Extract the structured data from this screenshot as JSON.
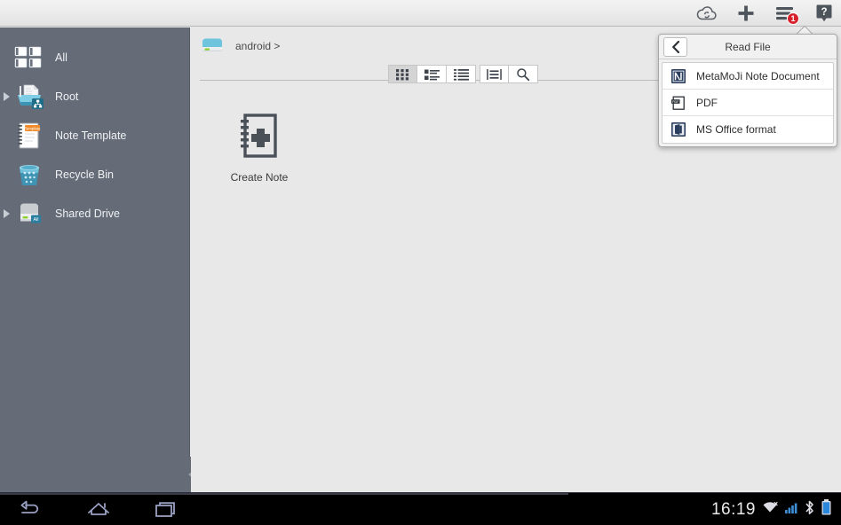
{
  "topbar": {
    "icons": [
      {
        "name": "cloud-sync-icon",
        "label": "Cloud Sync"
      },
      {
        "name": "add-icon",
        "label": "Add"
      },
      {
        "name": "menu-icon",
        "label": "Menu",
        "badge": "1"
      },
      {
        "name": "help-icon",
        "label": "Help"
      }
    ],
    "badge_count": "1",
    "badge_color": "#d6212a"
  },
  "sidebar": {
    "background": "#656c78",
    "items": [
      {
        "label": "All",
        "icon": "all-grid-icon",
        "expandable": false
      },
      {
        "label": "Root",
        "icon": "root-folder-icon",
        "expandable": true
      },
      {
        "label": "Note Template",
        "icon": "note-template-icon",
        "expandable": false
      },
      {
        "label": "Recycle Bin",
        "icon": "recycle-bin-icon",
        "expandable": false
      },
      {
        "label": "Shared Drive",
        "icon": "shared-drive-icon",
        "expandable": true
      }
    ],
    "collapse_handle": "collapse-sidebar-handle"
  },
  "main": {
    "breadcrumb": {
      "icon": "drive-icon",
      "text": "android >"
    },
    "toolbar": [
      {
        "name": "grid-view-button",
        "icon": "grid-icon",
        "active": true
      },
      {
        "name": "list-view-button",
        "icon": "list-icon",
        "active": false
      },
      {
        "name": "detail-view-button",
        "icon": "detail-list-icon",
        "active": false
      },
      {
        "name": "sort-button",
        "icon": "sort-icon",
        "active": false
      },
      {
        "name": "search-button",
        "icon": "search-icon",
        "active": false
      }
    ],
    "files": [
      {
        "label": "Create Note",
        "icon": "create-note-icon"
      }
    ]
  },
  "popup": {
    "title": "Read File",
    "back_label": "Back",
    "items": [
      {
        "label": "MetaMoJi Note Document",
        "icon": "metamoji-note-icon"
      },
      {
        "label": "PDF",
        "icon": "pdf-icon"
      },
      {
        "label": "MS Office format",
        "icon": "ms-office-icon"
      }
    ]
  },
  "navbar": {
    "buttons": [
      {
        "name": "back-button",
        "icon": "android-back-icon"
      },
      {
        "name": "home-button",
        "icon": "android-home-icon"
      },
      {
        "name": "recents-button",
        "icon": "android-recents-icon"
      }
    ],
    "clock": "16:19",
    "status_icons": [
      {
        "name": "wifi-icon"
      },
      {
        "name": "cellular-signal-icon"
      },
      {
        "name": "bluetooth-icon"
      },
      {
        "name": "battery-icon"
      }
    ]
  }
}
